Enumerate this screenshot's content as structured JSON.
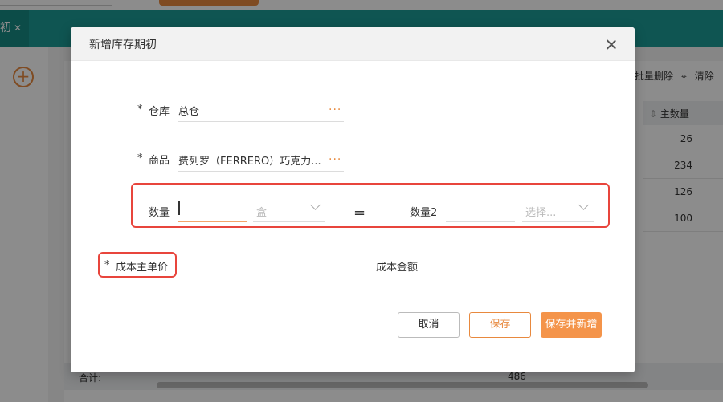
{
  "background": {
    "tab_label": "初",
    "toolbar": {
      "batch_delete": "批量删除",
      "clear": "清除"
    },
    "table": {
      "column_header": "主数量",
      "rows": [
        "26",
        "234",
        "126",
        "100"
      ],
      "footer_label": "合计:",
      "footer_total": "486"
    }
  },
  "modal": {
    "title": "新增库存期初",
    "warehouse": {
      "required_mark": "*",
      "label": "仓库",
      "value": "总仓",
      "more": "···"
    },
    "product": {
      "required_mark": "*",
      "label": "商品",
      "value": "费列罗（FERRERO）巧克力...",
      "more": "···"
    },
    "quantity": {
      "label": "数量",
      "value": "",
      "unit": "盒",
      "equals": "="
    },
    "quantity2": {
      "label": "数量2",
      "value": "",
      "unit_placeholder": "选择..."
    },
    "unit_cost": {
      "required_mark": "*",
      "label": "成本主单价",
      "value": ""
    },
    "cost_amount": {
      "label": "成本金额",
      "value": ""
    },
    "buttons": {
      "cancel": "取消",
      "save": "保存",
      "save_and_new": "保存并新增"
    }
  },
  "colors": {
    "accent_orange": "#f4944a",
    "highlight_red": "#e8453c",
    "teal_nav": "#1d9c96"
  }
}
